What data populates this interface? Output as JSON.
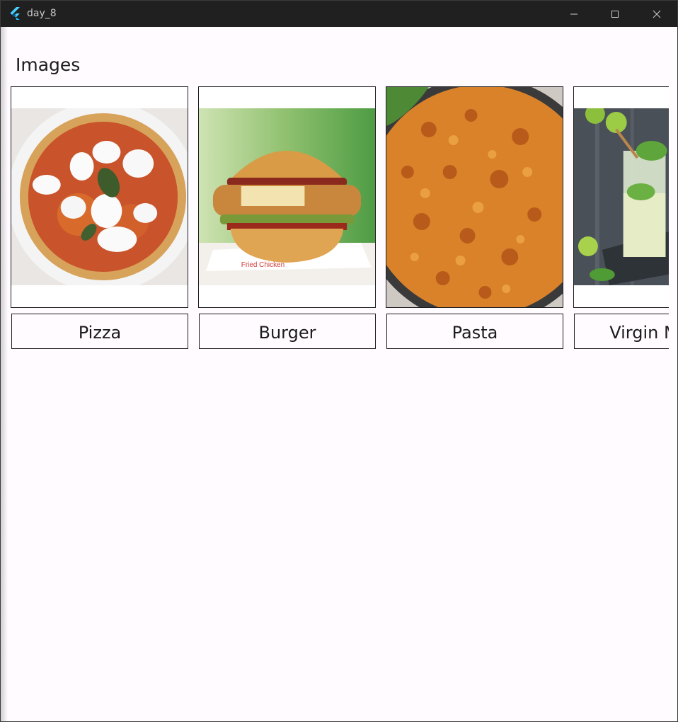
{
  "window": {
    "title": "day_8"
  },
  "page": {
    "title": "Images"
  },
  "items": [
    {
      "label": "Pizza",
      "image": "pizza-image"
    },
    {
      "label": "Burger",
      "image": "burger-image"
    },
    {
      "label": "Pasta",
      "image": "pasta-image"
    },
    {
      "label": "Virgin Mojito",
      "image": "mojito-image"
    }
  ],
  "colors": {
    "background": "#fffbfe",
    "titlebar": "#202020",
    "border": "#1c1b1f"
  }
}
